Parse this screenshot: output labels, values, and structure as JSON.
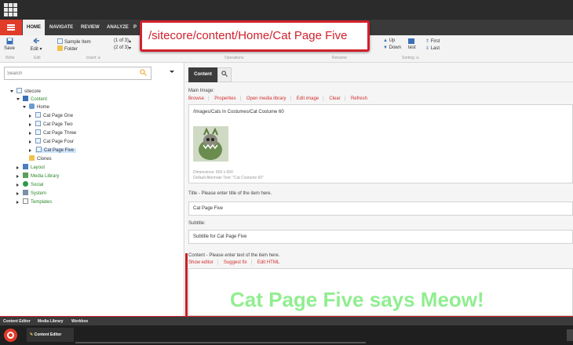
{
  "ribbon": {
    "tabs": [
      "HOME",
      "NAVIGATE",
      "REVIEW",
      "ANALYZE",
      "P"
    ],
    "save_label": "Save",
    "write_group": "Write",
    "edit_label": "Edit",
    "edit_group": "Edit",
    "insert_items": [
      {
        "label": "Sample Item",
        "count": "(1 of 3)"
      },
      {
        "label": "Folder",
        "count": "(2 of 3)"
      }
    ],
    "insert_group": "Insert",
    "operations_group": "Operations",
    "rename_group": "Rename",
    "sorting_items": [
      "Up",
      "Down",
      "First",
      "Last"
    ],
    "sorting_mid": "test",
    "sorting_group": "Sorting"
  },
  "callout": {
    "text": "/sitecore/content/Home/Cat Page Five"
  },
  "search": {
    "placeholder": "Search"
  },
  "tree": {
    "root": "sitecore",
    "content": "Content",
    "home": "Home",
    "pages": [
      "Cat Page One",
      "Cat Page Two",
      "Cat Page Three",
      "Cat Page Four",
      "Cat Page Five"
    ],
    "clones": "Clones",
    "others": [
      "Layout",
      "Media Library",
      "Social",
      "System",
      "Templates"
    ]
  },
  "editor": {
    "tab_label": "Content",
    "main_image_label": "Main Image:",
    "image_links": [
      "Browse",
      "Properties",
      "Open media library",
      "Edit image",
      "Clear",
      "Refresh"
    ],
    "image_path": "/Images/Cats In Costumes/Cat Costume 60",
    "dimensions": "Dimensions: 600 x 600",
    "alt_text": "Default Alternate Text: \"Cat Costume 60\"",
    "title_label": "Title - Please enter title of the item here.",
    "title_value": "Cat Page Five",
    "subtitle_label": "Subtitle:",
    "subtitle_value": "Subtitle for Cat Page Five",
    "content_label": "Content - Please enter text of the item here.",
    "rte_links": [
      "Show editor",
      "Suggest fix",
      "Edit HTML"
    ],
    "content_text": "Cat Page Five says Meow!"
  },
  "bottom_tabs": [
    "Content Editor",
    "Media Library",
    "Workbox"
  ],
  "taskbar": {
    "app_label": "Content Editor"
  }
}
